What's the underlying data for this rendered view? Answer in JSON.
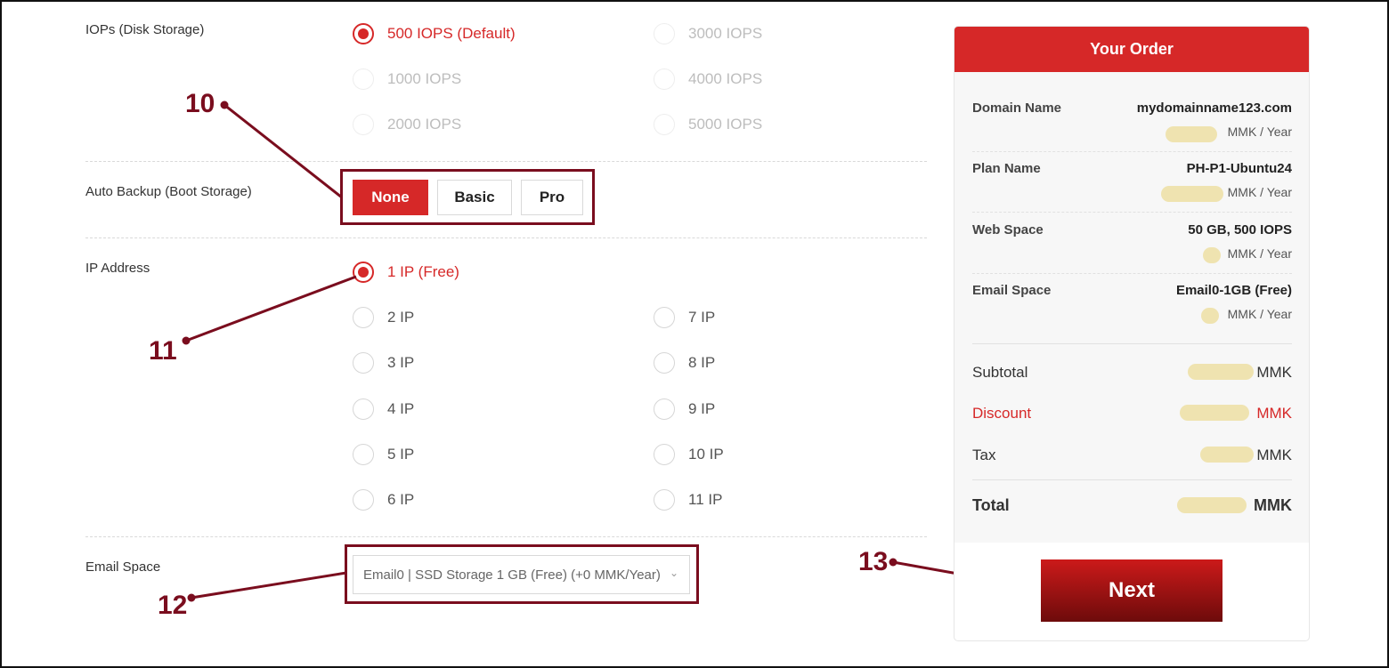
{
  "iops": {
    "label": "IOPs (Disk Storage)",
    "options": [
      "500 IOPS (Default)",
      "3000 IOPS",
      "1000 IOPS",
      "4000 IOPS",
      "2000 IOPS",
      "5000 IOPS"
    ],
    "selected": "500 IOPS (Default)"
  },
  "backup": {
    "label": "Auto Backup (Boot Storage)",
    "options": [
      "None",
      "Basic",
      "Pro"
    ],
    "selected": "None"
  },
  "ip": {
    "label": "IP Address",
    "options": [
      "1 IP (Free)",
      "2 IP",
      "3 IP",
      "4 IP",
      "5 IP",
      "6 IP",
      "7 IP",
      "8 IP",
      "9 IP",
      "10 IP",
      "11 IP"
    ],
    "selected": "1 IP (Free)"
  },
  "email": {
    "label": "Email Space",
    "selected": "Email0 | SSD Storage 1 GB (Free) (+0 MMK/Year)"
  },
  "annotations": [
    "10",
    "11",
    "12",
    "13"
  ],
  "order": {
    "title": "Your Order",
    "items": [
      {
        "key": "Domain Name",
        "value": "mydomainname123.com",
        "price": "MMK / Year"
      },
      {
        "key": "Plan Name",
        "value": "PH-P1-Ubuntu24",
        "price": "MMK / Year"
      },
      {
        "key": "Web Space",
        "value": "50 GB, 500 IOPS",
        "price": "MMK / Year"
      },
      {
        "key": "Email Space",
        "value": "Email0-1GB (Free)",
        "price": "MMK / Year"
      }
    ],
    "subtotal": {
      "key": "Subtotal",
      "value": "MMK"
    },
    "discount": {
      "key": "Discount",
      "value": "MMK"
    },
    "tax": {
      "key": "Tax",
      "value": "MMK"
    },
    "total": {
      "key": "Total",
      "value": "MMK"
    },
    "next_label": "Next"
  },
  "colors": {
    "accent": "#d62828",
    "annotation": "#7a0d1e",
    "redacted": "#efe3b0"
  }
}
